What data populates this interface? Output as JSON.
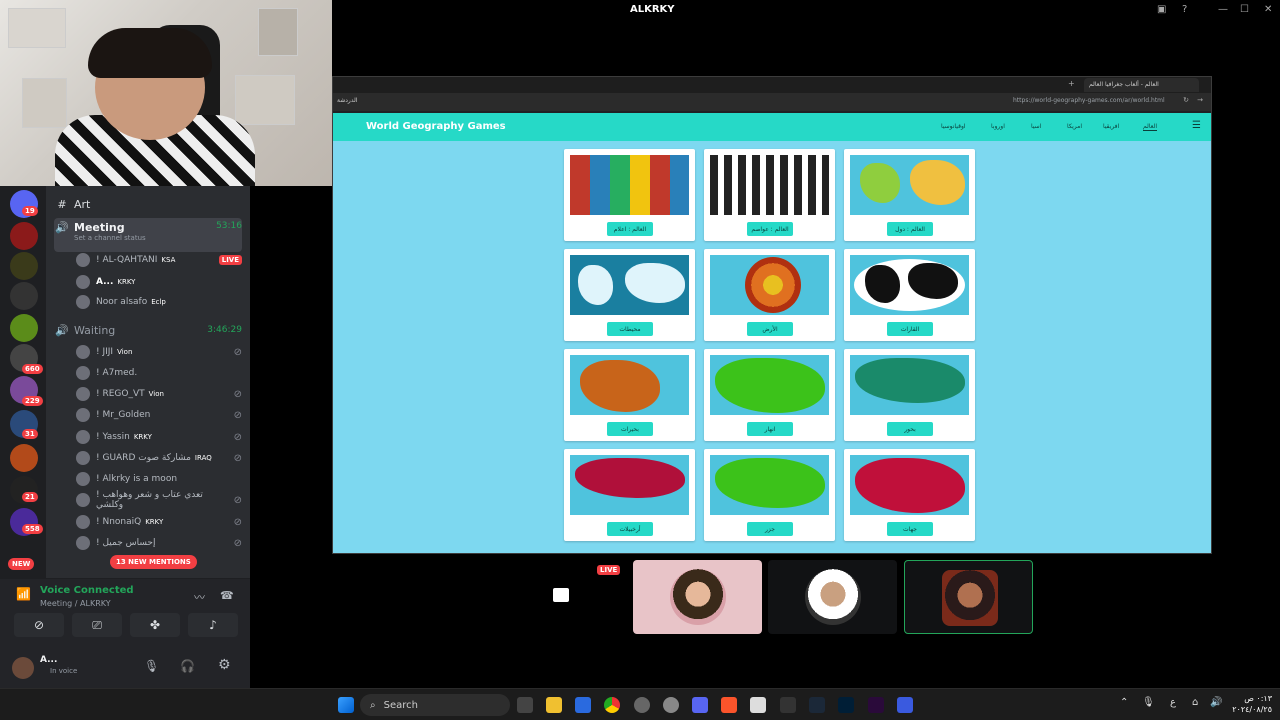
{
  "window": {
    "title": "ALKRKY"
  },
  "discord": {
    "channels": {
      "art": "Art",
      "meeting": "Meeting",
      "meeting_time": "53:16",
      "meeting_status": "Set a channel status",
      "waiting": "Waiting",
      "waiting_time": "3:46:29"
    },
    "meeting_members": [
      {
        "name": "! AL-QAHTANI",
        "tag": "KSA",
        "live": "LIVE"
      },
      {
        "name": "A...",
        "tag": "KRKY"
      },
      {
        "name": "Noor alsafo",
        "tag": "Eclp"
      }
    ],
    "waiting_members": [
      {
        "name": "! JIJI",
        "tag": "Vion"
      },
      {
        "name": "! A7med.",
        "tag": ""
      },
      {
        "name": "! REGO_VT",
        "tag": "Vion"
      },
      {
        "name": "! Mr_Golden",
        "tag": ""
      },
      {
        "name": "! Yassin",
        "tag": "KRKY"
      },
      {
        "name": "! GUARD مشاركة صوت",
        "tag": "IRAQ"
      },
      {
        "name": "! Alkrky is a moon",
        "tag": ""
      },
      {
        "name": "! تعدي عتاب و شعر وهواهب وكلشي",
        "tag": ""
      },
      {
        "name": "! NnonaiQ",
        "tag": "KRKY"
      },
      {
        "name": "! إحساس جميل",
        "tag": ""
      }
    ],
    "server_badges": [
      "19",
      "660",
      "229",
      "31",
      "21",
      "558",
      "NEW"
    ],
    "mentions": "13 NEW MENTIONS",
    "voice": {
      "title": "Voice Connected",
      "subtitle": "Meeting / ALKRKY"
    },
    "user": {
      "name": "A...",
      "status": "In voice"
    }
  },
  "browser": {
    "tab_title": "العالم - ألعاب جغرافيا العالم",
    "url": "https://world-geography-games.com/ar/world.html",
    "bookmark": "الدردشة",
    "site": {
      "logo": "World Geography Games",
      "nav": [
        "العالم",
        "افريقيا",
        "امريكا",
        "اسيا",
        "اوروبا",
        "اوقيانوسيا"
      ]
    },
    "cards": [
      {
        "label": "العالم : اعلام"
      },
      {
        "label": "العالم : عواصم"
      },
      {
        "label": "العالم : دول"
      },
      {
        "label": "محيطات"
      },
      {
        "label": "الأرض"
      },
      {
        "label": "القارات"
      },
      {
        "label": "بحيرات"
      },
      {
        "label": "انهار"
      },
      {
        "label": "بحور"
      },
      {
        "label": "أرخبيلات"
      },
      {
        "label": "جزر"
      },
      {
        "label": "جهات"
      }
    ]
  },
  "call": {
    "live_label": "LIVE"
  },
  "taskbar": {
    "search": "Search",
    "lang": "ع",
    "time": "٠:١٣ ص",
    "date": "٢٠٢٤/٠٨/٢٥"
  },
  "colors": {
    "site_header": "#26d9c7",
    "site_bg": "#7dd8f0",
    "live_red": "#f23f43",
    "voice_green": "#23a55a"
  }
}
